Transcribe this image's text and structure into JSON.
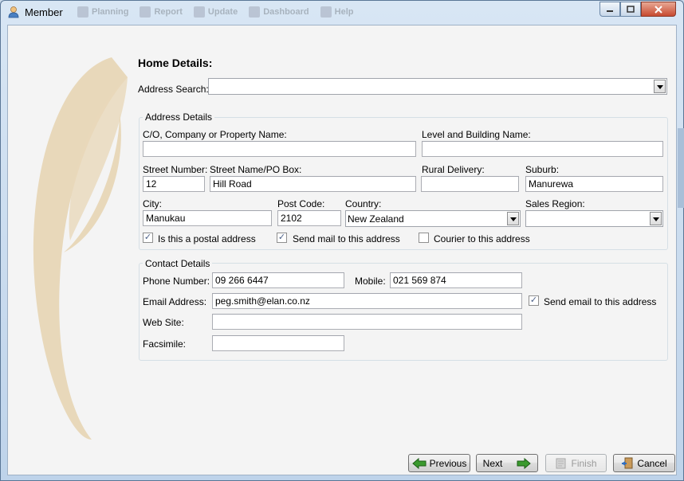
{
  "window": {
    "title": "Member",
    "ghost_menu": [
      "Planning",
      "Report",
      "Update",
      "Dashboard",
      "Help"
    ]
  },
  "form": {
    "heading": "Home Details:",
    "address_search": {
      "label": "Address Search:",
      "value": ""
    }
  },
  "address_details": {
    "title": "Address Details",
    "company_name": {
      "label": "C/O, Company or Property Name:",
      "value": ""
    },
    "level_building": {
      "label": "Level and Building Name:",
      "value": ""
    },
    "street_number": {
      "label": "Street Number:",
      "value": "12"
    },
    "street_name": {
      "label": "Street Name/PO Box:",
      "value": "Hill Road"
    },
    "rural_delivery": {
      "label": "Rural Delivery:",
      "value": ""
    },
    "suburb": {
      "label": "Suburb:",
      "value": "Manurewa"
    },
    "city": {
      "label": "City:",
      "value": "Manukau"
    },
    "post_code": {
      "label": "Post Code:",
      "value": "2102"
    },
    "country": {
      "label": "Country:",
      "value": "New Zealand"
    },
    "sales_region": {
      "label": "Sales Region:",
      "value": ""
    },
    "postal_address": {
      "label": "Is this a postal address",
      "checked": true
    },
    "send_mail": {
      "label": "Send mail to this address",
      "checked": true
    },
    "courier": {
      "label": "Courier to this address",
      "checked": false
    }
  },
  "contact_details": {
    "title": "Contact Details",
    "phone": {
      "label": "Phone Number:",
      "value": "09 266 6447"
    },
    "mobile": {
      "label": "Mobile:",
      "value": "021 569 874"
    },
    "email": {
      "label": "Email Address:",
      "value": "peg.smith@elan.co.nz"
    },
    "send_email": {
      "label": "Send email to this address",
      "checked": true
    },
    "website": {
      "label": "Web Site:",
      "value": ""
    },
    "fax": {
      "label": "Facsimile:",
      "value": ""
    }
  },
  "buttons": {
    "previous": "Previous",
    "next": "Next",
    "finish": "Finish",
    "cancel": "Cancel"
  },
  "colors": {
    "swirl": "#e8d8ba",
    "check": "#4a5f87"
  }
}
